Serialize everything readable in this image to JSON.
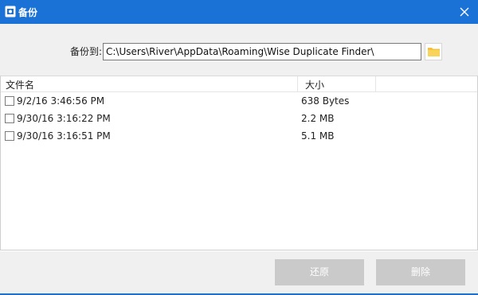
{
  "window": {
    "title": "备份",
    "app_icon": "app-logo-icon",
    "close_icon": "close-icon",
    "accent": "#1a72d6"
  },
  "backup_path": {
    "label": "备份到:",
    "value": "C:\\Users\\River\\AppData\\Roaming\\Wise Duplicate Finder\\",
    "browse_icon": "folder-icon"
  },
  "list": {
    "columns": [
      "文件名",
      "大小"
    ],
    "rows": [
      {
        "name": "9/2/16 3:46:56 PM",
        "size": "638 Bytes",
        "checked": false
      },
      {
        "name": "9/30/16 3:16:22 PM",
        "size": "2.2 MB",
        "checked": false
      },
      {
        "name": "9/30/16 3:16:51 PM",
        "size": "5.1 MB",
        "checked": false
      }
    ]
  },
  "buttons": {
    "restore": "还原",
    "delete": "删除",
    "disabled_color": "#cacaca"
  }
}
